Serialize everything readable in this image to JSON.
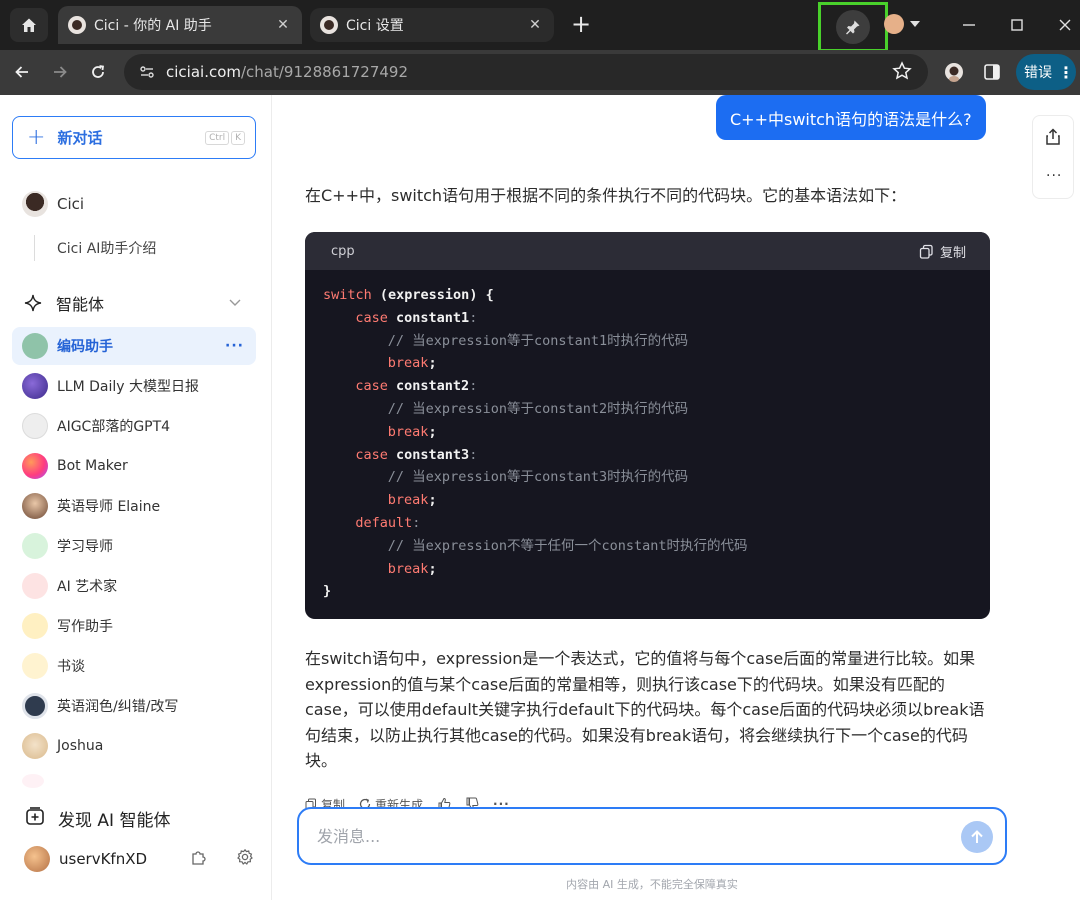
{
  "browser": {
    "tabs": [
      {
        "title": "Cici - 你的 AI 助手",
        "active": true
      },
      {
        "title": "Cici 设置",
        "active": false
      }
    ],
    "close_glyph": "✕",
    "new_tab_glyph": "+",
    "url_host": "ciciai.com",
    "url_path": "/chat/9128861727492",
    "error_label": "错误",
    "menu_glyph": "⋮",
    "icons": [
      "home-icon",
      "pin-icon",
      "minimize-icon",
      "maximize-icon",
      "close-icon",
      "back-icon",
      "forward-icon",
      "reload-icon",
      "site-info-icon",
      "star-icon",
      "profile-icon",
      "sidebar-icon"
    ]
  },
  "sidebar": {
    "new_chat_label": "新对话",
    "new_chat_plus": "+",
    "shortcut_keys": [
      "Ctrl",
      "K"
    ],
    "top_bot": "Cici",
    "top_bot_sub": "Cici AI助手介绍",
    "section_title": "智能体",
    "items": [
      {
        "label": "编码助手",
        "selected": true,
        "color": "#8fc3a9"
      },
      {
        "label": "LLM Daily 大模型日报",
        "color": "#6a4fb5"
      },
      {
        "label": "AIGC部落的GPT4",
        "color": "#e8e8e8"
      },
      {
        "label": "Bot Maker",
        "color": "#ff4f7a"
      },
      {
        "label": "英语导师 Elaine",
        "color": "#c79774"
      },
      {
        "label": "学习导师",
        "color": "#d8f3dc"
      },
      {
        "label": "AI 艺术家",
        "color": "#fde3e3"
      },
      {
        "label": "写作助手",
        "color": "#fff0c2"
      },
      {
        "label": "书谈",
        "color": "#fff3d0"
      },
      {
        "label": "英语润色/纠错/改写",
        "color": "#2f3b4e"
      },
      {
        "label": "Joshua",
        "color": "#f3e2c9"
      }
    ],
    "selected_more": "···",
    "discover_label": "发现 AI 智能体",
    "username": "uservKfnXD"
  },
  "chat": {
    "user_message": "C++中switch语句的语法是什么?",
    "intro": "在C++中，switch语句用于根据不同的条件执行不同的代码块。它的基本语法如下：",
    "code_lang": "cpp",
    "copy_label": "复制",
    "code_lines": [
      {
        "kw": "switch",
        "text": " (expression) {",
        "indent": 0,
        "type": "kwline"
      },
      {
        "kw": "case",
        "text": " constant1",
        "tail": ":",
        "indent": 1,
        "type": "case"
      },
      {
        "text": "// 当expression等于constant1时执行的代码",
        "indent": 2,
        "type": "comment"
      },
      {
        "kw": "break",
        "text": ";",
        "indent": 2,
        "type": "brk"
      },
      {
        "kw": "case",
        "text": " constant2",
        "tail": ":",
        "indent": 1,
        "type": "case"
      },
      {
        "text": "// 当expression等于constant2时执行的代码",
        "indent": 2,
        "type": "comment"
      },
      {
        "kw": "break",
        "text": ";",
        "indent": 2,
        "type": "brk"
      },
      {
        "kw": "case",
        "text": " constant3",
        "tail": ":",
        "indent": 1,
        "type": "case"
      },
      {
        "text": "// 当expression等于constant3时执行的代码",
        "indent": 2,
        "type": "comment"
      },
      {
        "kw": "break",
        "text": ";",
        "indent": 2,
        "type": "brk"
      },
      {
        "kw": "default",
        "text": "",
        "tail": ":",
        "indent": 1,
        "type": "case"
      },
      {
        "text": "// 当expression不等于任何一个constant时执行的代码",
        "indent": 2,
        "type": "comment"
      },
      {
        "kw": "break",
        "text": ";",
        "indent": 2,
        "type": "brk"
      },
      {
        "text": "}",
        "indent": 0,
        "type": "plain"
      }
    ],
    "explanation": "在switch语句中，expression是一个表达式，它的值将与每个case后面的常量进行比较。如果expression的值与某个case后面的常量相等，则执行该case下的代码块。如果没有匹配的case，可以使用default关键字执行default下的代码块。每个case后面的代码块必须以break语句结束，以防止执行其他case的代码。如果没有break语句，将会继续执行下一个case的代码块。",
    "actions": {
      "copy": "复制",
      "regenerate": "重新生成",
      "more": "···"
    },
    "side_more": "···",
    "input_placeholder": "发消息...",
    "disclaimer": "内容由 AI 生成，不能完全保障真实"
  },
  "colors": {
    "accent": "#1c6df2",
    "highlight": "#49d12b",
    "code_bg": "#161620",
    "keyword": "#ff7b72"
  }
}
